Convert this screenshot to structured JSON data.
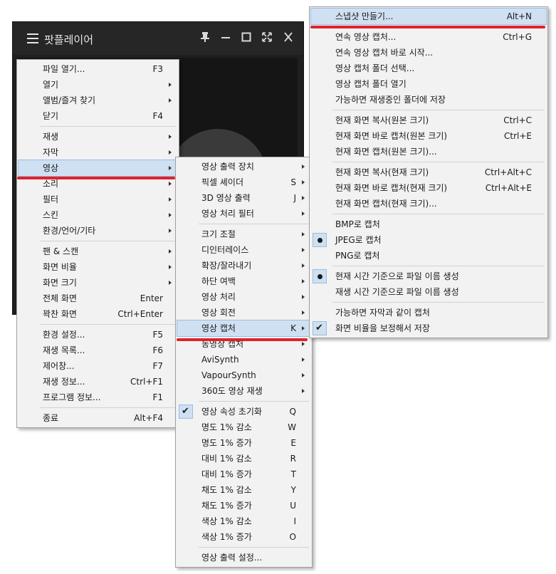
{
  "app": {
    "title": "팟플레이어"
  },
  "colors": {
    "highlight": "#cfe0f3",
    "accent_line": "#e0222b",
    "menu_bg": "#f2f2f2"
  },
  "main_menu": [
    {
      "label": "파일 열기...",
      "shortcut": "F3"
    },
    {
      "label": "열기",
      "arrow": true
    },
    {
      "label": "앨범/즐겨 찾기",
      "arrow": true
    },
    {
      "label": "닫기",
      "shortcut": "F4"
    },
    {
      "sep": true
    },
    {
      "label": "재생",
      "arrow": true
    },
    {
      "label": "자막",
      "arrow": true
    },
    {
      "label": "영상",
      "arrow": true,
      "highlight": true
    },
    {
      "label": "소리",
      "arrow": true
    },
    {
      "label": "필터",
      "arrow": true
    },
    {
      "label": "스킨",
      "arrow": true
    },
    {
      "label": "환경/언어/기타",
      "arrow": true
    },
    {
      "sep": true
    },
    {
      "label": "팬 & 스캔",
      "arrow": true
    },
    {
      "label": "화면 비율",
      "arrow": true
    },
    {
      "label": "화면 크기",
      "arrow": true
    },
    {
      "label": "전체 화면",
      "shortcut": "Enter"
    },
    {
      "label": "꽉찬 화면",
      "shortcut": "Ctrl+Enter"
    },
    {
      "sep": true
    },
    {
      "label": "환경 설정...",
      "shortcut": "F5"
    },
    {
      "label": "재생 목록...",
      "shortcut": "F6"
    },
    {
      "label": "제어창...",
      "shortcut": "F7"
    },
    {
      "label": "재생 정보...",
      "shortcut": "Ctrl+F1"
    },
    {
      "label": "프로그램 정보...",
      "shortcut": "F1"
    },
    {
      "sep": true
    },
    {
      "label": "종료",
      "shortcut": "Alt+F4"
    }
  ],
  "video_menu": [
    {
      "label": "영상 출력 장치",
      "arrow": true
    },
    {
      "label": "픽셀 셰이더",
      "shortcut": "S",
      "arrow": true
    },
    {
      "label": "3D 영상 출력",
      "shortcut": "J",
      "arrow": true
    },
    {
      "label": "영상 처리 필터",
      "arrow": true
    },
    {
      "sep": true
    },
    {
      "label": "크기 조절",
      "arrow": true
    },
    {
      "label": "디인터레이스",
      "arrow": true
    },
    {
      "label": "확장/잘라내기",
      "arrow": true
    },
    {
      "label": "하단 여백",
      "arrow": true
    },
    {
      "label": "영상 처리",
      "arrow": true
    },
    {
      "label": "영상 회전",
      "arrow": true
    },
    {
      "label": "영상 캡처",
      "shortcut": "K",
      "arrow": true,
      "highlight": true
    },
    {
      "label": "동영상 캡처",
      "arrow": true
    },
    {
      "label": "AviSynth",
      "arrow": true
    },
    {
      "label": "VapourSynth",
      "arrow": true
    },
    {
      "label": "360도 영상 재생",
      "arrow": true
    },
    {
      "sep": true
    },
    {
      "label": "영상 속성 초기화",
      "shortcut": "Q",
      "check": "tick"
    },
    {
      "label": "명도 1% 감소",
      "shortcut": "W"
    },
    {
      "label": "명도 1% 증가",
      "shortcut": "E"
    },
    {
      "label": "대비 1% 감소",
      "shortcut": "R"
    },
    {
      "label": "대비 1% 증가",
      "shortcut": "T"
    },
    {
      "label": "채도 1% 감소",
      "shortcut": "Y"
    },
    {
      "label": "채도 1% 증가",
      "shortcut": "U"
    },
    {
      "label": "색상 1% 감소",
      "shortcut": "I"
    },
    {
      "label": "색상 1% 증가",
      "shortcut": "O"
    },
    {
      "sep": true
    },
    {
      "label": "영상 출력 설정..."
    }
  ],
  "capture_menu": [
    {
      "label": "스냅샷 만들기...",
      "shortcut": "Alt+N",
      "highlight": true
    },
    {
      "sep": true
    },
    {
      "label": "연속 영상 캡처...",
      "shortcut": "Ctrl+G"
    },
    {
      "label": "연속 영상 캡처 바로 시작..."
    },
    {
      "label": "영상 캡처 폴더 선택..."
    },
    {
      "label": "영상 캡처 폴더 열기"
    },
    {
      "label": "가능하면 재생중인 폴더에 저장"
    },
    {
      "sep": true
    },
    {
      "label": "현재 화면 복사(원본 크기)",
      "shortcut": "Ctrl+C"
    },
    {
      "label": "현재 화면 바로 캡처(원본 크기)",
      "shortcut": "Ctrl+E"
    },
    {
      "label": "현재 화면 캡처(원본 크기)..."
    },
    {
      "sep": true
    },
    {
      "label": "현재 화면 복사(현재 크기)",
      "shortcut": "Ctrl+Alt+C"
    },
    {
      "label": "현재 화면 바로 캡처(현재 크기)",
      "shortcut": "Ctrl+Alt+E"
    },
    {
      "label": "현재 화면 캡처(현재 크기)..."
    },
    {
      "sep": true
    },
    {
      "label": "BMP로 캡처"
    },
    {
      "label": "JPEG로 캡처",
      "check": "dot"
    },
    {
      "label": "PNG로 캡처"
    },
    {
      "sep": true
    },
    {
      "label": "현재 시간 기준으로 파일 이름 생성",
      "check": "dot"
    },
    {
      "label": "재생 시간 기준으로 파일 이름 생성"
    },
    {
      "sep": true
    },
    {
      "label": "가능하면 자막과 같이 캡처"
    },
    {
      "label": "화면 비율을 보정해서 저장",
      "check": "tick"
    }
  ]
}
